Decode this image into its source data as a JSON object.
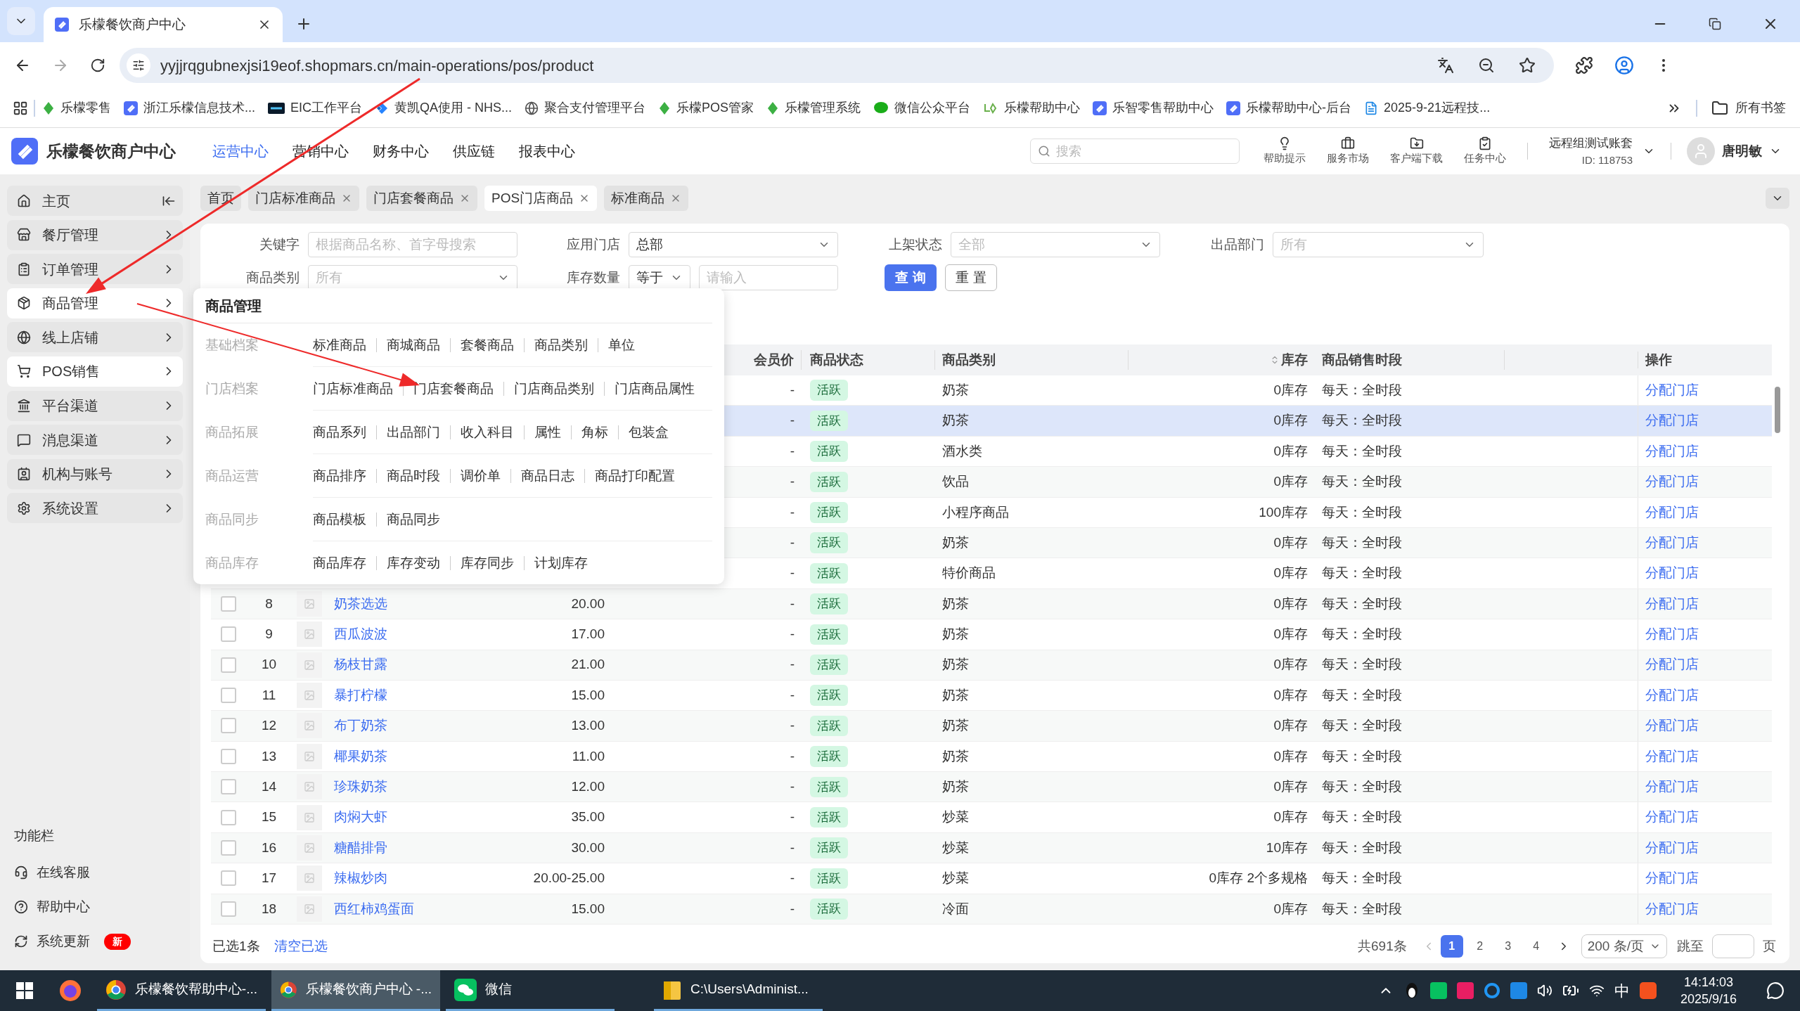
{
  "browser": {
    "tab_title": "乐檬餐饮商户中心",
    "url": "yyjjrqgubnexjsi19eof.shopmars.cn/main-operations/pos/product",
    "bookmarks": [
      {
        "label": "乐檬零售",
        "kind": "leaf"
      },
      {
        "label": "浙江乐檬信息技术...",
        "kind": "brand"
      },
      {
        "label": "EIC工作平台",
        "kind": "eic"
      },
      {
        "label": "黄凯QA使用 - NHS...",
        "kind": "jira"
      },
      {
        "label": "聚合支付管理平台",
        "kind": "globe"
      },
      {
        "label": "乐檬POS管家",
        "kind": "leaf"
      },
      {
        "label": "乐檬管理系统",
        "kind": "leaf"
      },
      {
        "label": "微信公众平台",
        "kind": "chat"
      },
      {
        "label": "乐檬帮助中心",
        "kind": "lemon"
      },
      {
        "label": "乐智零售帮助中心",
        "kind": "brand"
      },
      {
        "label": "乐檬帮助中心-后台",
        "kind": "brand"
      },
      {
        "label": "2025-9-21远程技...",
        "kind": "doc"
      }
    ],
    "all_bookmarks": "所有书签"
  },
  "app": {
    "title": "乐檬餐饮商户中心",
    "nav": [
      {
        "label": "运营中心",
        "selected": true
      },
      {
        "label": "营销中心",
        "selected": false
      },
      {
        "label": "财务中心",
        "selected": false
      },
      {
        "label": "供应链",
        "selected": false
      },
      {
        "label": "报表中心",
        "selected": false
      }
    ],
    "search_placeholder": "搜索",
    "tools": [
      "帮助提示",
      "服务市场",
      "客户端下载",
      "任务中心"
    ],
    "account": {
      "name": "远程组测试账套",
      "id": "ID: 118753"
    },
    "user": "唐明敏"
  },
  "sidebar": {
    "items": [
      {
        "label": "主页",
        "kind": "home",
        "selected": false
      },
      {
        "label": "餐厅管理",
        "kind": "menu",
        "selected": false
      },
      {
        "label": "订单管理",
        "kind": "menu",
        "selected": false
      },
      {
        "label": "商品管理",
        "kind": "menu",
        "selected": true
      },
      {
        "label": "线上店铺",
        "kind": "menu",
        "selected": false
      },
      {
        "label": "POS销售",
        "kind": "menu",
        "selected": true
      },
      {
        "label": "平台渠道",
        "kind": "menu",
        "selected": false
      },
      {
        "label": "消息渠道",
        "kind": "menu",
        "selected": false
      },
      {
        "label": "机构与账号",
        "kind": "menu",
        "selected": false
      },
      {
        "label": "系统设置",
        "kind": "menu",
        "selected": false
      }
    ],
    "function_bar": {
      "title": "功能栏",
      "items": [
        {
          "label": "在线客服"
        },
        {
          "label": "帮助中心"
        },
        {
          "label": "系统更新",
          "badge": "新"
        }
      ]
    }
  },
  "page_tabs": [
    {
      "label": "首页",
      "closable": false,
      "selected": false
    },
    {
      "label": "门店标准商品",
      "closable": true,
      "selected": false
    },
    {
      "label": "门店套餐商品",
      "closable": true,
      "selected": false
    },
    {
      "label": "POS门店商品",
      "closable": true,
      "selected": true
    },
    {
      "label": "标准商品",
      "closable": true,
      "selected": false
    }
  ],
  "filters": {
    "keyword": {
      "label": "关键字",
      "placeholder": "根据商品名称、首字母搜索"
    },
    "store": {
      "label": "应用门店",
      "value": "总部"
    },
    "shelf_status": {
      "label": "上架状态",
      "placeholder": "全部"
    },
    "department": {
      "label": "出品部门",
      "placeholder": "所有"
    },
    "category": {
      "label": "商品类别",
      "placeholder": "所有"
    },
    "stock": {
      "label": "库存数量",
      "operator": "等于",
      "placeholder": "请输入"
    },
    "query_button": "查 询",
    "reset_button": "重 置"
  },
  "table": {
    "columns": [
      "会员价",
      "商品状态",
      "商品类别",
      "库存",
      "商品销售时段",
      "操作"
    ],
    "rows": [
      {
        "member_price": "-",
        "status": "活跃",
        "category": "奶茶",
        "stock": "0库存",
        "time": "每天：全时段",
        "action": "分配门店",
        "selected": false
      },
      {
        "member_price": "-",
        "status": "活跃",
        "category": "奶茶",
        "stock": "0库存",
        "time": "每天：全时段",
        "action": "分配门店",
        "selected": true
      },
      {
        "member_price": "-",
        "status": "活跃",
        "category": "酒水类",
        "stock": "0库存",
        "time": "每天：全时段",
        "action": "分配门店",
        "selected": false
      },
      {
        "member_price": "-",
        "status": "活跃",
        "category": "饮品",
        "stock": "0库存",
        "time": "每天：全时段",
        "action": "分配门店",
        "selected": false
      },
      {
        "member_price": "-",
        "status": "活跃",
        "category": "小程序商品",
        "stock": "100库存",
        "time": "每天：全时段",
        "action": "分配门店",
        "selected": false
      },
      {
        "member_price": "-",
        "status": "活跃",
        "category": "奶茶",
        "stock": "0库存",
        "time": "每天：全时段",
        "action": "分配门店",
        "selected": false
      },
      {
        "member_price": "-",
        "status": "活跃",
        "category": "特价商品",
        "stock": "0库存",
        "time": "每天：全时段",
        "action": "分配门店",
        "selected": false
      },
      {
        "index": "8",
        "name": "奶茶选选",
        "price": "20.00",
        "member_price": "-",
        "status": "活跃",
        "category": "奶茶",
        "stock": "0库存",
        "time": "每天：全时段",
        "action": "分配门店",
        "selected": false
      },
      {
        "index": "9",
        "name": "西瓜波波",
        "price": "17.00",
        "member_price": "-",
        "status": "活跃",
        "category": "奶茶",
        "stock": "0库存",
        "time": "每天：全时段",
        "action": "分配门店",
        "selected": false
      },
      {
        "index": "10",
        "name": "杨枝甘露",
        "price": "21.00",
        "member_price": "-",
        "status": "活跃",
        "category": "奶茶",
        "stock": "0库存",
        "time": "每天：全时段",
        "action": "分配门店",
        "selected": false
      },
      {
        "index": "11",
        "name": "暴打柠檬",
        "price": "15.00",
        "member_price": "-",
        "status": "活跃",
        "category": "奶茶",
        "stock": "0库存",
        "time": "每天：全时段",
        "action": "分配门店",
        "selected": false
      },
      {
        "index": "12",
        "name": "布丁奶茶",
        "price": "13.00",
        "member_price": "-",
        "status": "活跃",
        "category": "奶茶",
        "stock": "0库存",
        "time": "每天：全时段",
        "action": "分配门店",
        "selected": false
      },
      {
        "index": "13",
        "name": "椰果奶茶",
        "price": "11.00",
        "member_price": "-",
        "status": "活跃",
        "category": "奶茶",
        "stock": "0库存",
        "time": "每天：全时段",
        "action": "分配门店",
        "selected": false
      },
      {
        "index": "14",
        "name": "珍珠奶茶",
        "price": "12.00",
        "member_price": "-",
        "status": "活跃",
        "category": "奶茶",
        "stock": "0库存",
        "time": "每天：全时段",
        "action": "分配门店",
        "selected": false
      },
      {
        "index": "15",
        "name": "肉焖大虾",
        "price": "35.00",
        "member_price": "-",
        "status": "活跃",
        "category": "炒菜",
        "stock": "0库存",
        "time": "每天：全时段",
        "action": "分配门店",
        "selected": false
      },
      {
        "index": "16",
        "name": "糖醋排骨",
        "price": "30.00",
        "member_price": "-",
        "status": "活跃",
        "category": "炒菜",
        "stock": "10库存",
        "time": "每天：全时段",
        "action": "分配门店",
        "selected": false
      },
      {
        "index": "17",
        "name": "辣椒炒肉",
        "price": "20.00-25.00",
        "member_price": "-",
        "status": "活跃",
        "category": "炒菜",
        "stock": "0库存 2个多规格",
        "time": "每天：全时段",
        "action": "分配门店",
        "selected": false
      },
      {
        "index": "18",
        "name": "西红柿鸡蛋面",
        "price": "15.00",
        "member_price": "-",
        "status": "活跃",
        "category": "冷面",
        "stock": "0库存",
        "time": "每天：全时段",
        "action": "分配门店",
        "selected": false
      }
    ]
  },
  "footer": {
    "selected_count": "已选1条",
    "clear": "清空已选",
    "total": "共691条",
    "pages": [
      {
        "label": "1",
        "selected": true
      },
      {
        "label": "2",
        "selected": false
      },
      {
        "label": "3",
        "selected": false
      },
      {
        "label": "4",
        "selected": false
      }
    ],
    "page_size": "200 条/页",
    "jump_label": "跳至",
    "page_unit": "页"
  },
  "menu": {
    "title": "商品管理",
    "groups": [
      {
        "label": "基础档案",
        "items": [
          "标准商品",
          "商城商品",
          "套餐商品",
          "商品类别",
          "单位"
        ]
      },
      {
        "label": "门店档案",
        "items": [
          "门店标准商品",
          "门店套餐商品",
          "门店商品类别",
          "门店商品属性"
        ]
      },
      {
        "label": "商品拓展",
        "items": [
          "商品系列",
          "出品部门",
          "收入科目",
          "属性",
          "角标",
          "包装盒"
        ]
      },
      {
        "label": "商品运营",
        "items": [
          "商品排序",
          "商品时段",
          "调价单",
          "商品日志",
          "商品打印配置"
        ]
      },
      {
        "label": "商品同步",
        "items": [
          "商品模板",
          "商品同步"
        ]
      },
      {
        "label": "商品库存",
        "items": [
          "商品库存",
          "库存变动",
          "库存同步",
          "计划库存"
        ]
      }
    ]
  },
  "taskbar": {
    "items": [
      {
        "kind": "firefox",
        "active": false
      },
      {
        "kind": "chrome",
        "label": "乐檬餐饮帮助中心-...",
        "active": false
      },
      {
        "kind": "chrome",
        "label": "乐檬餐饮商户中心 -...",
        "active": true
      },
      {
        "kind": "wechat",
        "label": "微信",
        "active": false
      },
      {
        "kind": "folder",
        "label": "C:\\Users\\Administ...",
        "active": false
      }
    ],
    "ime": "中",
    "time": "14:14:03",
    "date": "2025/9/16"
  }
}
